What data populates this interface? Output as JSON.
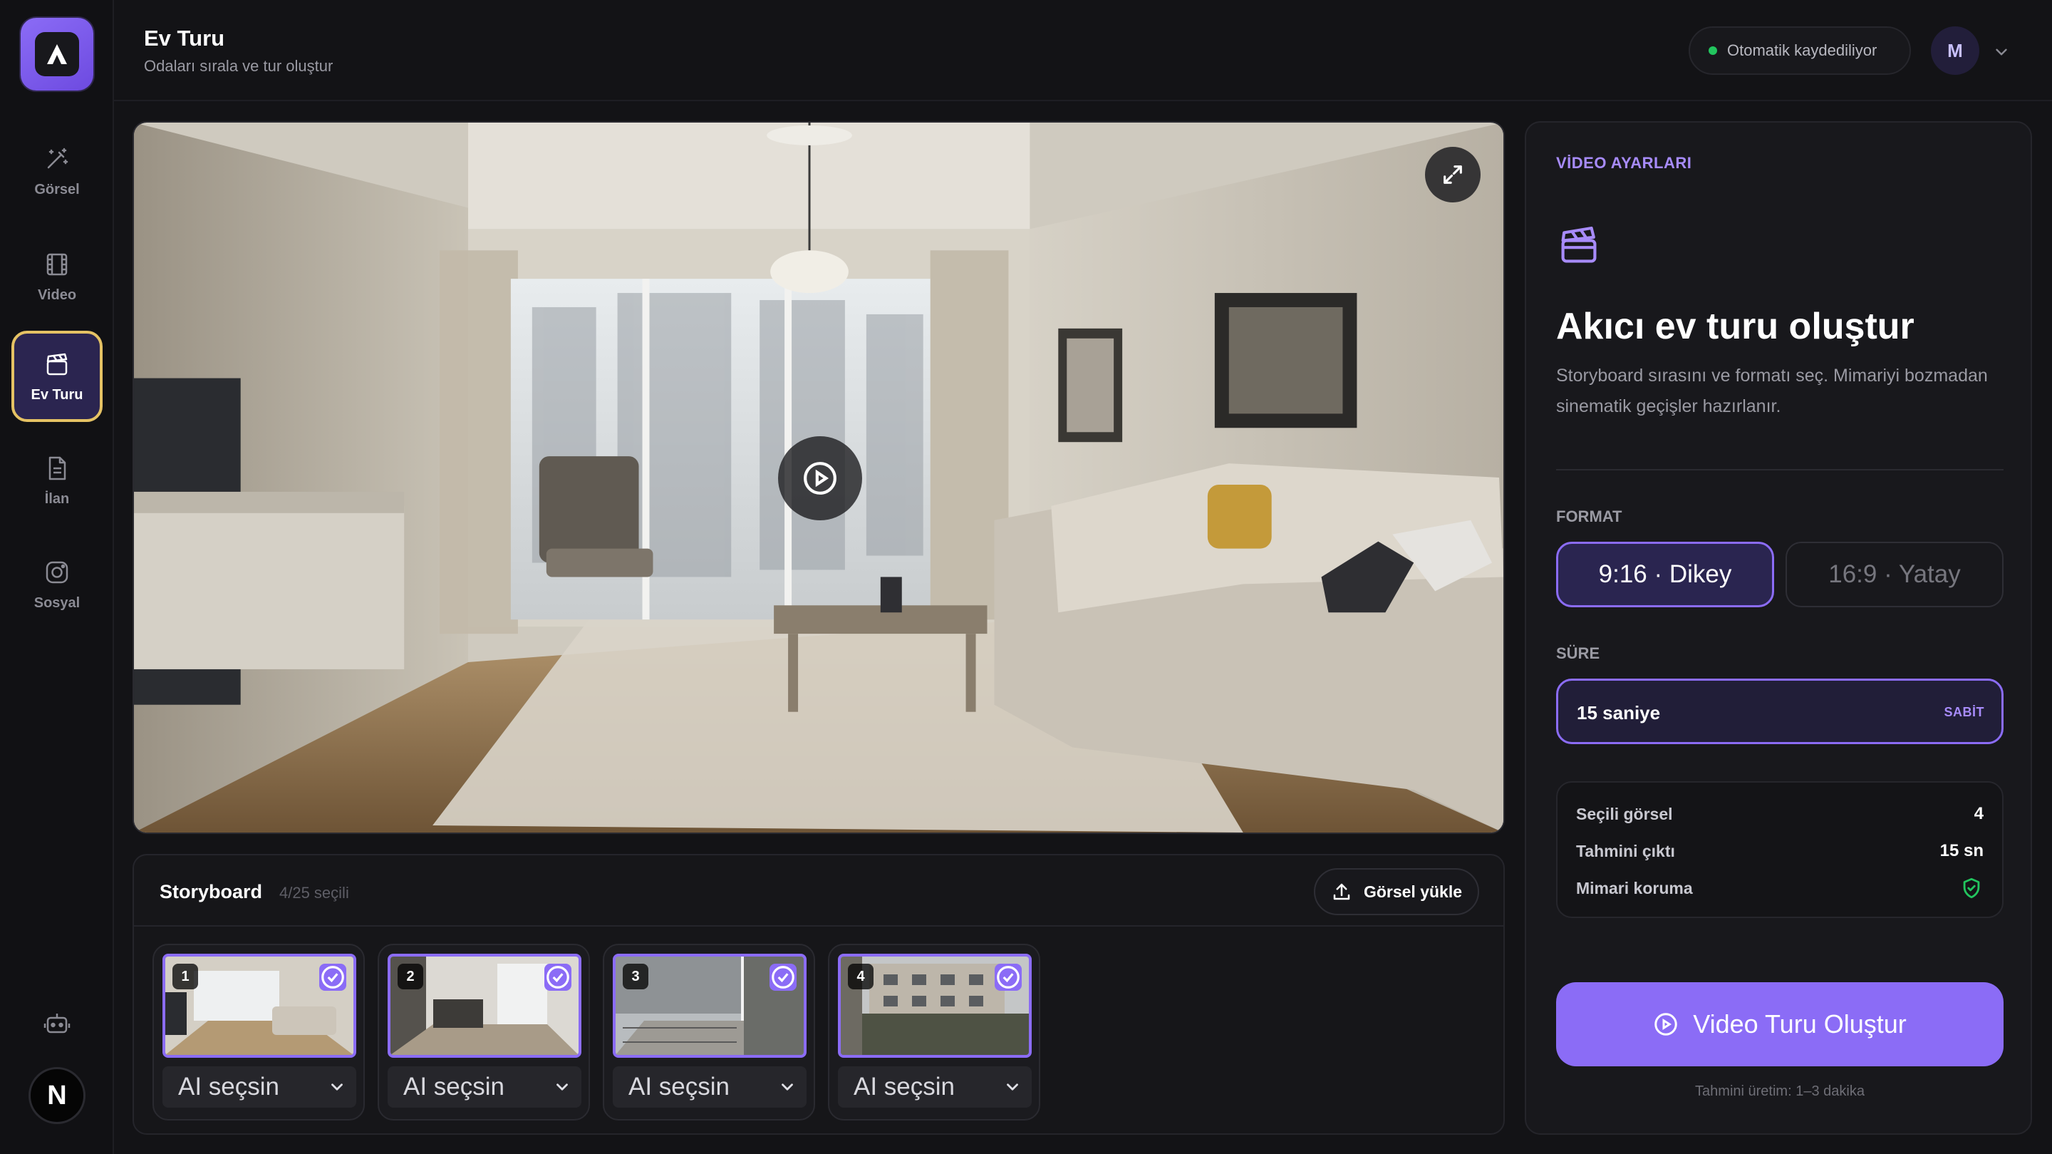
{
  "sidebar": {
    "items": [
      {
        "label": "Görsel",
        "icon": "magic-wand-icon"
      },
      {
        "label": "Video",
        "icon": "film-icon"
      },
      {
        "label": "Ev Turu",
        "icon": "clapperboard-icon",
        "active": true
      },
      {
        "label": "İlan",
        "icon": "document-icon"
      },
      {
        "label": "Sosyal",
        "icon": "instagram-icon"
      }
    ],
    "bottom_avatar": "N"
  },
  "header": {
    "title": "Ev Turu",
    "subtitle": "Odaları sırala ve tur oluştur",
    "autosave": "Otomatik kaydediliyor",
    "user_initial": "M"
  },
  "storyboard": {
    "title": "Storyboard",
    "count": "4/25 seçili",
    "upload_label": "Görsel yükle",
    "items": [
      {
        "index": "1",
        "select_value": "AI seçsin"
      },
      {
        "index": "2",
        "select_value": "AI seçsin"
      },
      {
        "index": "3",
        "select_value": "AI seçsin"
      },
      {
        "index": "4",
        "select_value": "AI seçsin"
      }
    ]
  },
  "panel": {
    "kicker": "VİDEO AYARLARI",
    "title": "Akıcı ev turu oluştur",
    "description": "Storyboard sırasını ve formatı seç. Mimariyi bozmadan sinematik geçişler hazırlanır.",
    "format_label": "FORMAT",
    "format_options": [
      {
        "label": "9:16 · Dikey",
        "selected": true
      },
      {
        "label": "16:9 · Yatay",
        "selected": false
      }
    ],
    "duration_label": "SÜRE",
    "duration_value": "15 saniye",
    "duration_badge": "SABİT",
    "summary": [
      {
        "key": "Seçili görsel",
        "value": "4"
      },
      {
        "key": "Tahmini çıktı",
        "value": "15 sn"
      },
      {
        "key": "Mimari koruma",
        "value": ""
      }
    ],
    "cta_label": "Video Turu Oluştur",
    "cta_note": "Tahmini üretim: 1–3 dakika"
  },
  "colors": {
    "accent": "#8b6cf6",
    "accent_light": "#a78bfa",
    "active_border": "#e5c264",
    "status_green": "#22c55e",
    "background": "#131316"
  }
}
